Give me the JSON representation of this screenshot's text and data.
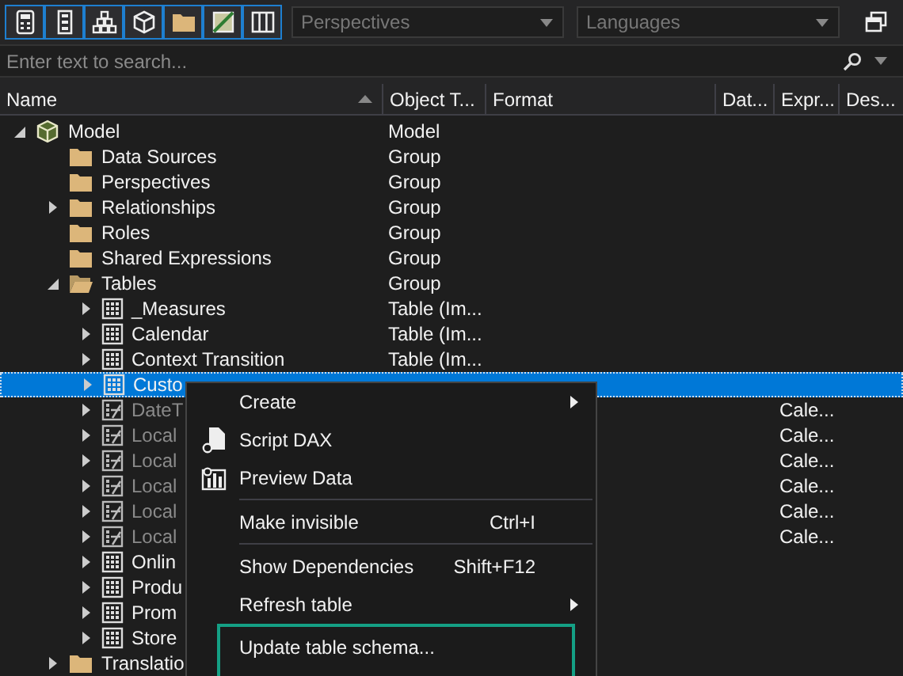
{
  "toolbar": {
    "buttons": [
      {
        "on": true
      },
      {
        "on": true
      },
      {
        "on": true
      },
      {
        "on": true
      },
      {
        "on": true
      },
      {
        "on": true
      },
      {
        "on": true
      }
    ],
    "perspectives": {
      "placeholder": "Perspectives"
    },
    "languages": {
      "placeholder": "Languages"
    }
  },
  "search": {
    "placeholder": "Enter text to search..."
  },
  "columns": [
    {
      "label": "Name",
      "sorted": true
    },
    {
      "label": "Object T...",
      "sorted": false
    },
    {
      "label": "Format",
      "sorted": false
    },
    {
      "label": "Dat...",
      "sorted": false
    },
    {
      "label": "Expr...",
      "sorted": false
    },
    {
      "label": "Des...",
      "sorted": false
    }
  ],
  "tree": [
    {
      "name": "Model",
      "type": "Model",
      "kind": "model",
      "expandable": true,
      "expanded": true,
      "selected": false,
      "hidden": false,
      "children": [
        {
          "name": "Data Sources",
          "type": "Group",
          "kind": "folder",
          "expandable": false,
          "expanded": false,
          "selected": false,
          "hidden": false
        },
        {
          "name": "Perspectives",
          "type": "Group",
          "kind": "folder",
          "expandable": false,
          "expanded": false,
          "selected": false,
          "hidden": false
        },
        {
          "name": "Relationships",
          "type": "Group",
          "kind": "folder",
          "expandable": true,
          "expanded": false,
          "selected": false,
          "hidden": false
        },
        {
          "name": "Roles",
          "type": "Group",
          "kind": "folder",
          "expandable": false,
          "expanded": false,
          "selected": false,
          "hidden": false
        },
        {
          "name": "Shared Expressions",
          "type": "Group",
          "kind": "folder",
          "expandable": false,
          "expanded": false,
          "selected": false,
          "hidden": false
        },
        {
          "name": "Tables",
          "type": "Group",
          "kind": "folder",
          "expandable": true,
          "expanded": true,
          "selected": false,
          "hidden": false,
          "children": [
            {
              "name": "_Measures",
              "type": "Table (Im...",
              "kind": "table",
              "expandable": true,
              "expanded": false,
              "selected": false,
              "hidden": false
            },
            {
              "name": "Calendar",
              "type": "Table (Im...",
              "kind": "table",
              "expandable": true,
              "expanded": false,
              "selected": false,
              "hidden": false
            },
            {
              "name": "Context Transition",
              "type": "Table (Im...",
              "kind": "table",
              "expandable": true,
              "expanded": false,
              "selected": false,
              "hidden": false
            },
            {
              "name": "Custo",
              "kind": "table",
              "expandable": true,
              "expanded": false,
              "selected": true,
              "hidden": false
            },
            {
              "name": "DateT",
              "expression": "Cale...",
              "kind": "calculated",
              "expandable": true,
              "expanded": false,
              "selected": false,
              "hidden": true
            },
            {
              "name": "Local",
              "expression": "Cale...",
              "kind": "calculated",
              "expandable": true,
              "expanded": false,
              "selected": false,
              "hidden": true
            },
            {
              "name": "Local",
              "expression": "Cale...",
              "kind": "calculated",
              "expandable": true,
              "expanded": false,
              "selected": false,
              "hidden": true
            },
            {
              "name": "Local",
              "expression": "Cale...",
              "kind": "calculated",
              "expandable": true,
              "expanded": false,
              "selected": false,
              "hidden": true
            },
            {
              "name": "Local",
              "expression": "Cale...",
              "kind": "calculated",
              "expandable": true,
              "expanded": false,
              "selected": false,
              "hidden": true
            },
            {
              "name": "Local",
              "expression": "Cale...",
              "kind": "calculated",
              "expandable": true,
              "expanded": false,
              "selected": false,
              "hidden": true
            },
            {
              "name": "Onlin",
              "kind": "table",
              "expandable": true,
              "expanded": false,
              "selected": false,
              "hidden": false
            },
            {
              "name": "Produ",
              "kind": "table",
              "expandable": true,
              "expanded": false,
              "selected": false,
              "hidden": false
            },
            {
              "name": "Prom",
              "kind": "table",
              "expandable": true,
              "expanded": false,
              "selected": false,
              "hidden": false
            },
            {
              "name": "Store",
              "kind": "table",
              "expandable": true,
              "expanded": false,
              "selected": false,
              "hidden": false
            }
          ]
        },
        {
          "name": "Translatio",
          "kind": "folder",
          "expandable": true,
          "expanded": false,
          "selected": false,
          "hidden": false
        }
      ]
    }
  ],
  "context_menu": [
    {
      "kind": "plain",
      "label": "Create",
      "submenu": true,
      "highlighted": false
    },
    {
      "kind": "document",
      "label": "Script DAX",
      "submenu": false,
      "highlighted": false
    },
    {
      "kind": "chart",
      "label": "Preview Data",
      "submenu": false,
      "highlighted": false
    },
    {
      "kind": "separator"
    },
    {
      "kind": "plain",
      "label": "Make invisible",
      "shortcut": "Ctrl+I",
      "submenu": false,
      "highlighted": false
    },
    {
      "kind": "separator"
    },
    {
      "kind": "plain",
      "label": "Show Dependencies",
      "shortcut": "Shift+F12",
      "submenu": false,
      "highlighted": false
    },
    {
      "kind": "plain",
      "label": "Refresh table",
      "submenu": true,
      "highlighted": false
    },
    {
      "kind": "plain",
      "label": "Update table schema...",
      "submenu": false,
      "highlighted": true
    }
  ]
}
